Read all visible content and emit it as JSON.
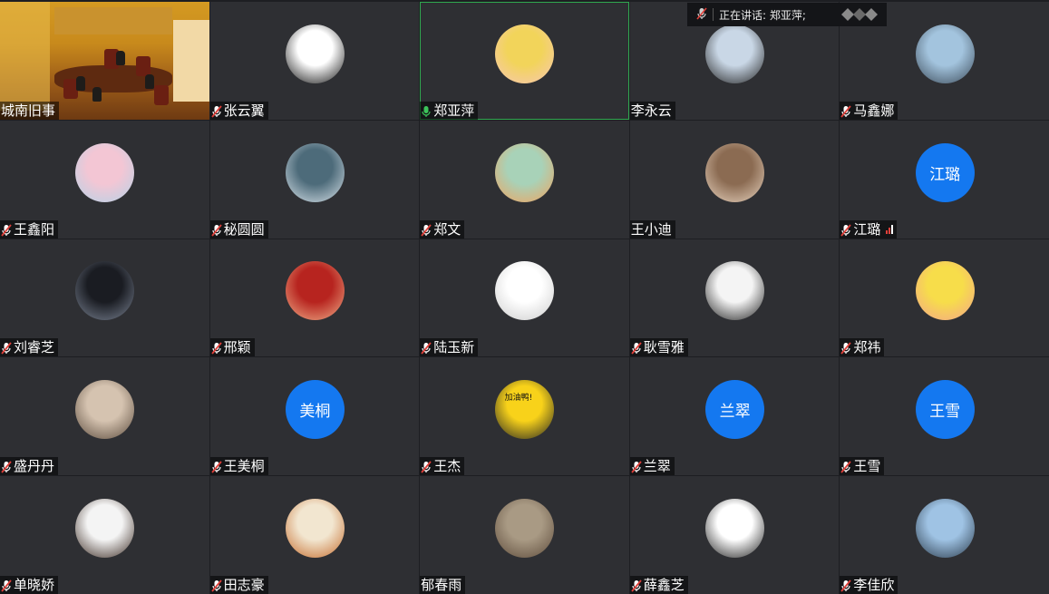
{
  "speaking_banner": {
    "label": "正在讲话: 郑亚萍;"
  },
  "participants": [
    {
      "name": "城南旧事",
      "avatar": {
        "kind": "video"
      },
      "muted": false,
      "active": false
    },
    {
      "name": "张云翼",
      "avatar": {
        "kind": "image",
        "colors": [
          "#ffffff",
          "#111111"
        ],
        "icon": "seal-character-icon"
      },
      "muted": true
    },
    {
      "name": "郑亚萍",
      "avatar": {
        "kind": "image",
        "colors": [
          "#f2d45a",
          "#f7c7b5"
        ],
        "icon": "cartoon-girl-icon"
      },
      "muted": false,
      "active": true,
      "mic_on": true
    },
    {
      "name": "李永云",
      "avatar": {
        "kind": "image",
        "colors": [
          "#c9d7e6",
          "#222222"
        ],
        "icon": "person-sunglasses-icon"
      },
      "muted": false
    },
    {
      "name": "马鑫娜",
      "avatar": {
        "kind": "image",
        "colors": [
          "#a3c4de",
          "#3b4a58"
        ],
        "icon": "person-pinwheel-icon"
      },
      "muted": true
    },
    {
      "name": "王鑫阳",
      "avatar": {
        "kind": "image",
        "colors": [
          "#f3c6d4",
          "#b4d3e8"
        ],
        "icon": "blossom-icon"
      },
      "muted": true
    },
    {
      "name": "秘圆圆",
      "avatar": {
        "kind": "image",
        "colors": [
          "#4d6b7a",
          "#d9e3ea"
        ],
        "icon": "person-car-icon"
      },
      "muted": true
    },
    {
      "name": "郑文",
      "avatar": {
        "kind": "image",
        "colors": [
          "#a8d2b8",
          "#f1a25e"
        ],
        "icon": "flowers-icon"
      },
      "muted": true
    },
    {
      "name": "王小迪",
      "avatar": {
        "kind": "image",
        "colors": [
          "#8b6b52",
          "#e8d4c0"
        ],
        "icon": "dog-icon"
      },
      "muted": false
    },
    {
      "name": "江璐",
      "avatar": {
        "kind": "text",
        "text": "江璐"
      },
      "muted": true,
      "signal": true
    },
    {
      "name": "刘睿芝",
      "avatar": {
        "kind": "image",
        "colors": [
          "#1a1c22",
          "#7b8494"
        ],
        "icon": "silhouette-icon"
      },
      "muted": true
    },
    {
      "name": "邢颖",
      "avatar": {
        "kind": "image",
        "colors": [
          "#b7241f",
          "#f0b08a"
        ],
        "icon": "person-red-icon"
      },
      "muted": true
    },
    {
      "name": "陆玉新",
      "avatar": {
        "kind": "image",
        "colors": [
          "#ffffff",
          "#cccccc"
        ],
        "icon": "doodle-icon"
      },
      "muted": true
    },
    {
      "name": "耿雪雅",
      "avatar": {
        "kind": "image",
        "colors": [
          "#f4f4f4",
          "#202020"
        ],
        "icon": "anime-girl-icon"
      },
      "muted": true
    },
    {
      "name": "郑祎",
      "avatar": {
        "kind": "image",
        "colors": [
          "#f7dd4a",
          "#f3a58c"
        ],
        "icon": "pikachu-icon"
      },
      "muted": true
    },
    {
      "name": "盛丹丹",
      "avatar": {
        "kind": "image",
        "colors": [
          "#d5c3b0",
          "#5a4a3c"
        ],
        "icon": "person-flowers-icon"
      },
      "muted": true
    },
    {
      "name": "王美桐",
      "avatar": {
        "kind": "text",
        "text": "美桐"
      },
      "muted": true
    },
    {
      "name": "王杰",
      "avatar": {
        "kind": "image",
        "colors": [
          "#f8d21a",
          "#222222"
        ],
        "icon": "duck-sticker-icon",
        "caption": "加油鸭!"
      },
      "muted": true
    },
    {
      "name": "兰翠",
      "avatar": {
        "kind": "text",
        "text": "兰翠"
      },
      "muted": true
    },
    {
      "name": "王雪",
      "avatar": {
        "kind": "text",
        "text": "王雪"
      },
      "muted": true
    },
    {
      "name": "单晓娇",
      "avatar": {
        "kind": "image",
        "colors": [
          "#f4f4f4",
          "#3a2a22"
        ],
        "icon": "portrait-icon"
      },
      "muted": true
    },
    {
      "name": "田志豪",
      "avatar": {
        "kind": "image",
        "colors": [
          "#f2e6d0",
          "#c46a2a"
        ],
        "icon": "tiger-icon"
      },
      "muted": true
    },
    {
      "name": "郁春雨",
      "avatar": {
        "kind": "image",
        "colors": [
          "#a99a84",
          "#5c4a3a"
        ],
        "icon": "person-back-icon"
      },
      "muted": false
    },
    {
      "name": "薛鑫芝",
      "avatar": {
        "kind": "image",
        "colors": [
          "#ffffff",
          "#1e1e1e"
        ],
        "icon": "cartoon-blob-icon"
      },
      "muted": true
    },
    {
      "name": "李佳欣",
      "avatar": {
        "kind": "image",
        "colors": [
          "#9fc3e4",
          "#2a3a4a"
        ],
        "icon": "couple-jump-icon"
      },
      "muted": true
    }
  ],
  "colors": {
    "tile_bg": "#2e2f33",
    "active_border": "#2fa84f",
    "text_avatar_bg": "#1478f0",
    "muted_red": "#e0403a",
    "mic_green": "#3cc45a"
  }
}
